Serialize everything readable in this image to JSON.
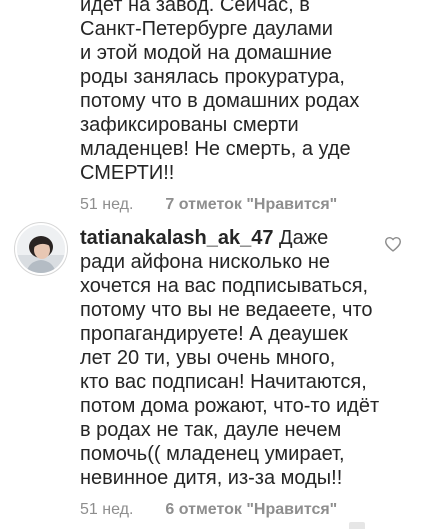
{
  "comments": [
    {
      "lines": [
        "идет на завод. Сейчас, в",
        "Санкт-Петербурге даулами",
        "и этой модой на домашние",
        "роды занялась прокуратура,",
        "потому что в домашних родах",
        "зафиксированы смерти",
        "младенцев! Не смерть, а уде",
        "СМЕРТИ!!"
      ],
      "time": "51 нед.",
      "likes": "7 отметок \"Нравится\"",
      "reply": ""
    },
    {
      "username": "tatianakalash_ak_47",
      "first_line_rest": " Даже",
      "lines": [
        "ради айфона нисколько не",
        "хочется на вас подписываться,",
        "потому что вы не ведаеете, что",
        "пропагандируете! А деаушек",
        "лет 20 ти, увы очень много,",
        "кто вас подписан! Начитаются,",
        "потом дома рожают, что-то идёт",
        "в родах не так, дауле нечем",
        "помочь(( младенец умирает,",
        "невинное дитя, из-за моды!!"
      ],
      "time": "51 нед.",
      "likes": "6 отметок \"Нравится\"",
      "reply": ""
    }
  ],
  "icons": {
    "heart": "heart-outline-icon",
    "avatar": "user-avatar"
  },
  "colors": {
    "text": "#262626",
    "meta": "#8e8e8e",
    "background": "#ffffff"
  }
}
